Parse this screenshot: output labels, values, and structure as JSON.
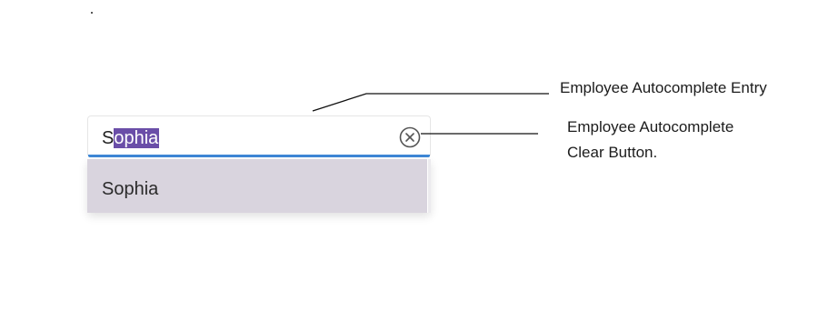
{
  "autocomplete": {
    "typed_prefix": "S",
    "suggested_completion": "ophia",
    "clear_icon": "circle-x-icon"
  },
  "dropdown": {
    "options": [
      {
        "label": "Sophia",
        "highlighted": true
      }
    ]
  },
  "callouts": {
    "entry_label": "Employee Autocomplete Entry",
    "clear_label_line1": "Employee Autocomplete",
    "clear_label_line2": "Clear Button."
  },
  "colors": {
    "selection": "#6a4ea8",
    "focus_underline": "#3f88d6",
    "option_highlight": "#d9d4de"
  }
}
